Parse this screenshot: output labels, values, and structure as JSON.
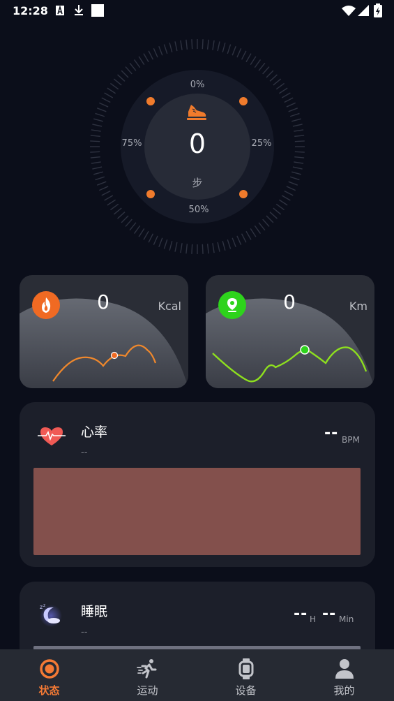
{
  "status_bar": {
    "time": "12:28"
  },
  "gauge": {
    "steps": "0",
    "unit": "步",
    "pct_top": "0%",
    "pct_right": "25%",
    "pct_bottom": "50%",
    "pct_left": "75%",
    "progress": 0
  },
  "calories": {
    "value": "0",
    "unit": "Kcal",
    "color": "#f06a23"
  },
  "distance": {
    "value": "0",
    "unit": "Km",
    "color": "#2ed31c"
  },
  "heart_rate": {
    "title": "心率",
    "subtitle": "--",
    "value": "--",
    "unit": "BPM",
    "chart_color": "#83504c"
  },
  "sleep": {
    "title": "睡眠",
    "subtitle": "--",
    "hours": "--",
    "hours_unit": "H",
    "minutes": "--",
    "minutes_unit": "Min"
  },
  "nav": {
    "items": [
      {
        "label": "状态",
        "icon": "status-ring-icon",
        "active": true
      },
      {
        "label": "运动",
        "icon": "running-icon",
        "active": false
      },
      {
        "label": "设备",
        "icon": "watch-icon",
        "active": false
      },
      {
        "label": "我的",
        "icon": "person-icon",
        "active": false
      }
    ],
    "accent": "#f47a35"
  }
}
